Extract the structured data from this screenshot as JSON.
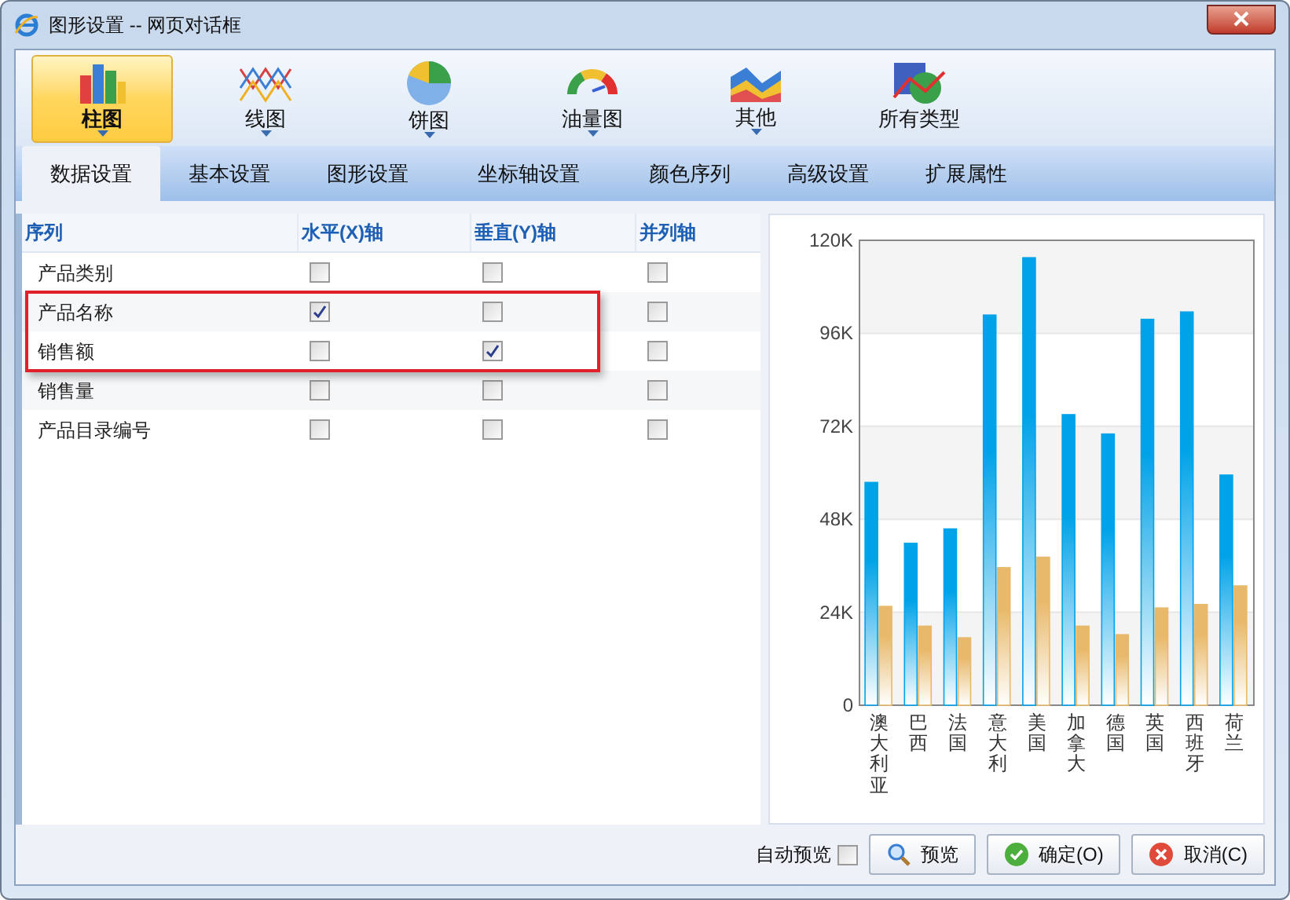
{
  "window": {
    "title": "图形设置 -- 网页对话框"
  },
  "chart_types": [
    {
      "label": "柱图",
      "kind": "bar",
      "selected": true,
      "dropdown": true
    },
    {
      "label": "线图",
      "kind": "line",
      "selected": false,
      "dropdown": true
    },
    {
      "label": "饼图",
      "kind": "pie",
      "selected": false,
      "dropdown": true
    },
    {
      "label": "油量图",
      "kind": "gauge",
      "selected": false,
      "dropdown": true
    },
    {
      "label": "其他",
      "kind": "area",
      "selected": false,
      "dropdown": true
    },
    {
      "label": "所有类型",
      "kind": "all",
      "selected": false,
      "dropdown": false
    }
  ],
  "tabs": [
    {
      "label": "数据设置",
      "selected": true
    },
    {
      "label": "基本设置",
      "selected": false
    },
    {
      "label": "图形设置",
      "selected": false
    },
    {
      "label": "坐标轴设置",
      "selected": false
    },
    {
      "label": "颜色序列",
      "selected": false
    },
    {
      "label": "高级设置",
      "selected": false
    },
    {
      "label": "扩展属性",
      "selected": false
    }
  ],
  "table": {
    "columns": [
      "序列",
      "水平(X)轴",
      "垂直(Y)轴",
      "并列轴"
    ],
    "rows": [
      {
        "name": "产品类别",
        "x": false,
        "y": false,
        "parallel": false,
        "highlighted": false
      },
      {
        "name": "产品名称",
        "x": true,
        "y": false,
        "parallel": false,
        "highlighted": true
      },
      {
        "name": "销售额",
        "x": false,
        "y": true,
        "parallel": false,
        "highlighted": true
      },
      {
        "name": "销售量",
        "x": false,
        "y": false,
        "parallel": false,
        "highlighted": false
      },
      {
        "name": "产品目录编号",
        "x": false,
        "y": false,
        "parallel": false,
        "highlighted": false
      }
    ]
  },
  "preview": {
    "chart_data": {
      "type": "bar",
      "categories": [
        "澳大利亚",
        "巴西",
        "法国",
        "意大利",
        "美国",
        "加拿大",
        "德国",
        "英国",
        "西班牙",
        "荷兰"
      ],
      "series": [
        {
          "color": "#00a2e8",
          "values": [
            57500,
            41800,
            45500,
            100700,
            115500,
            75000,
            70000,
            99600,
            101500,
            59400
          ]
        },
        {
          "color": "#e8b96a",
          "values": [
            25500,
            20400,
            17400,
            35500,
            38200,
            20400,
            18200,
            25100,
            26000,
            30800
          ]
        }
      ],
      "ylim": [
        0,
        120000
      ],
      "grid": true,
      "yticks": [
        {
          "value": 0,
          "label": "0"
        },
        {
          "value": 24000,
          "label": "24K"
        },
        {
          "value": 48000,
          "label": "48K"
        },
        {
          "value": 72000,
          "label": "72K"
        },
        {
          "value": 96000,
          "label": "96K"
        },
        {
          "value": 120000,
          "label": "120K"
        }
      ]
    }
  },
  "footer": {
    "auto_preview": {
      "label": "自动预览",
      "checked": false
    },
    "buttons": [
      {
        "label": "预览",
        "kind": "preview"
      },
      {
        "label": "确定(O)",
        "kind": "ok"
      },
      {
        "label": "取消(C)",
        "kind": "cancel"
      }
    ]
  }
}
